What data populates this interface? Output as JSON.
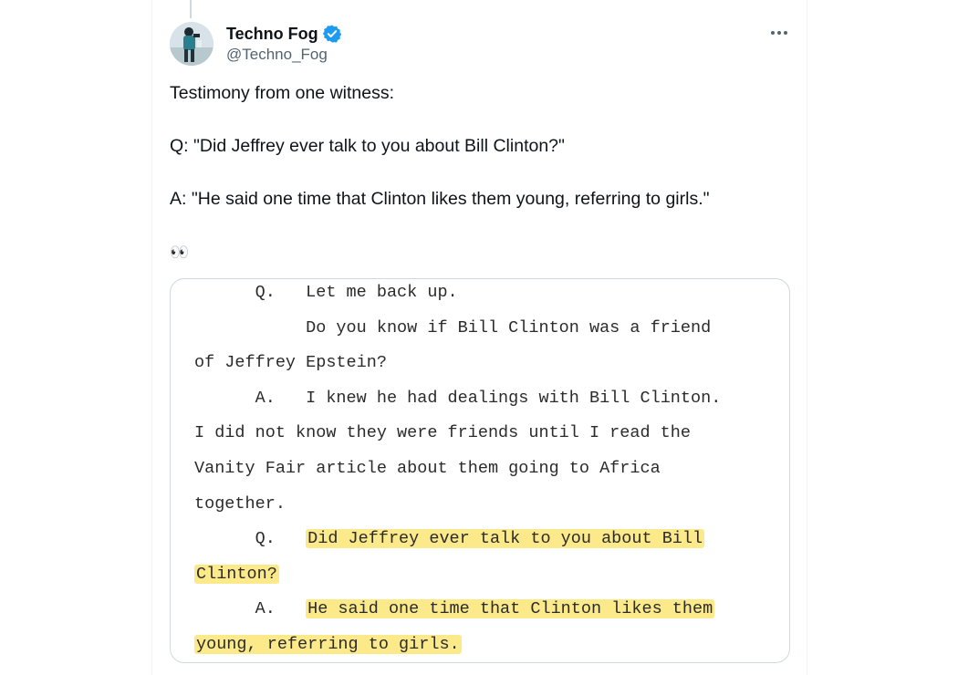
{
  "tweet": {
    "author": {
      "display_name": "Techno Fog",
      "handle": "@Techno_Fog",
      "verified": true
    },
    "more_icon": "more-horizontal-icon",
    "text": [
      "Testimony from one witness:",
      "Q: \"Did Jeffrey ever talk to you about Bill Clinton?\"",
      "A: \"He said one time that Clinton likes them young, referring to girls.\""
    ],
    "emoji": "👀"
  },
  "media": {
    "transcript": [
      {
        "indent": "      ",
        "speaker": "Q.",
        "text": "Let me back up.",
        "highlight": false
      },
      {
        "indent": "           ",
        "speaker": "",
        "text": "Do you know if Bill Clinton was a friend",
        "highlight": false
      },
      {
        "indent": "",
        "speaker": "",
        "text": "of Jeffrey Epstein?",
        "highlight": false
      },
      {
        "indent": "      ",
        "speaker": "A.",
        "text": "I knew he had dealings with Bill Clinton.",
        "highlight": false
      },
      {
        "indent": "",
        "speaker": "",
        "text": "I did not know they were friends until I read the",
        "highlight": false
      },
      {
        "indent": "",
        "speaker": "",
        "text": "Vanity Fair article about them going to Africa",
        "highlight": false
      },
      {
        "indent": "",
        "speaker": "",
        "text": "together.",
        "highlight": false
      },
      {
        "indent": "      ",
        "speaker": "Q.",
        "text": "Did Jeffrey ever talk to you about Bill",
        "highlight": true
      },
      {
        "indent": "",
        "speaker": "",
        "text": "Clinton?",
        "highlight": true
      },
      {
        "indent": "      ",
        "speaker": "A.",
        "text": "He said one time that Clinton likes them",
        "highlight": true
      },
      {
        "indent": "",
        "speaker": "",
        "text": "young, referring to girls.",
        "highlight": true
      }
    ],
    "highlight_color": "#fbe98a"
  },
  "colors": {
    "verified": "#1d9bf0",
    "secondary_text": "#536471",
    "border": "#cfd9de"
  }
}
